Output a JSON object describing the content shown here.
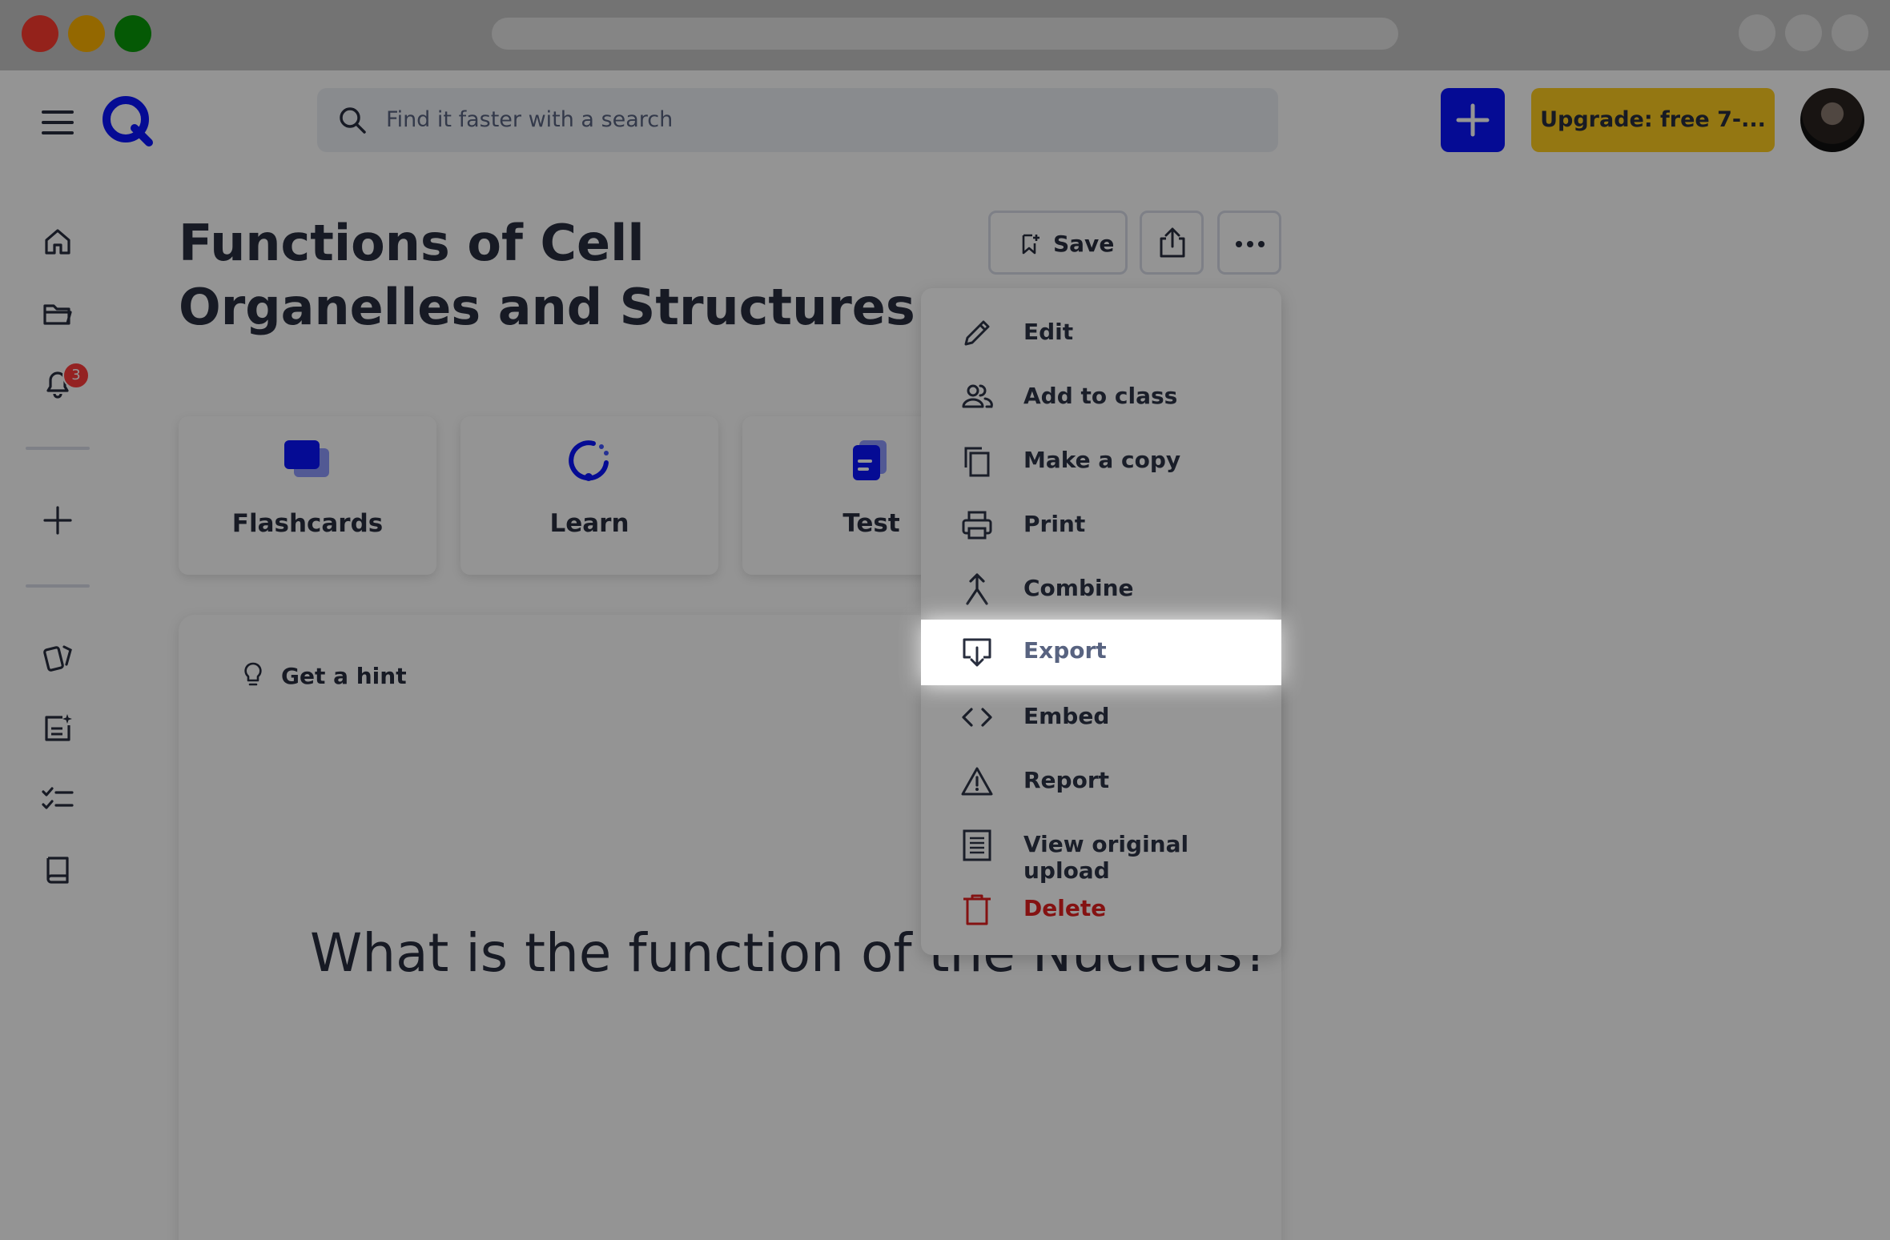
{
  "header": {
    "search_placeholder": "Find it faster with a search",
    "upgrade_label": "Upgrade: free 7-..."
  },
  "sidebar": {
    "notification_count": "3"
  },
  "page": {
    "title": "Functions of Cell Organelles and Structures",
    "save_label": "Save"
  },
  "modes": [
    {
      "label": "Flashcards"
    },
    {
      "label": "Learn"
    },
    {
      "label": "Test"
    }
  ],
  "flashcard": {
    "hint_label": "Get a hint",
    "question": "What is the function of the Nucleus?"
  },
  "menu": {
    "items": [
      {
        "label": "Edit",
        "icon": "pencil-icon"
      },
      {
        "label": "Add to class",
        "icon": "people-icon"
      },
      {
        "label": "Make a copy",
        "icon": "copy-icon"
      },
      {
        "label": "Print",
        "icon": "printer-icon"
      },
      {
        "label": "Combine",
        "icon": "merge-icon"
      },
      {
        "label": "Export",
        "icon": "export-icon",
        "highlighted": true
      },
      {
        "label": "Embed",
        "icon": "code-icon"
      },
      {
        "label": "Report",
        "icon": "warning-icon"
      },
      {
        "label": "View original upload",
        "icon": "document-icon"
      },
      {
        "label": "Delete",
        "icon": "trash-icon",
        "danger": true
      }
    ]
  },
  "colors": {
    "brand_blue": "#0a14ff",
    "upgrade_yellow": "#ffcd1f",
    "danger_red": "#c81b1b",
    "text_dark": "#282e3e"
  }
}
